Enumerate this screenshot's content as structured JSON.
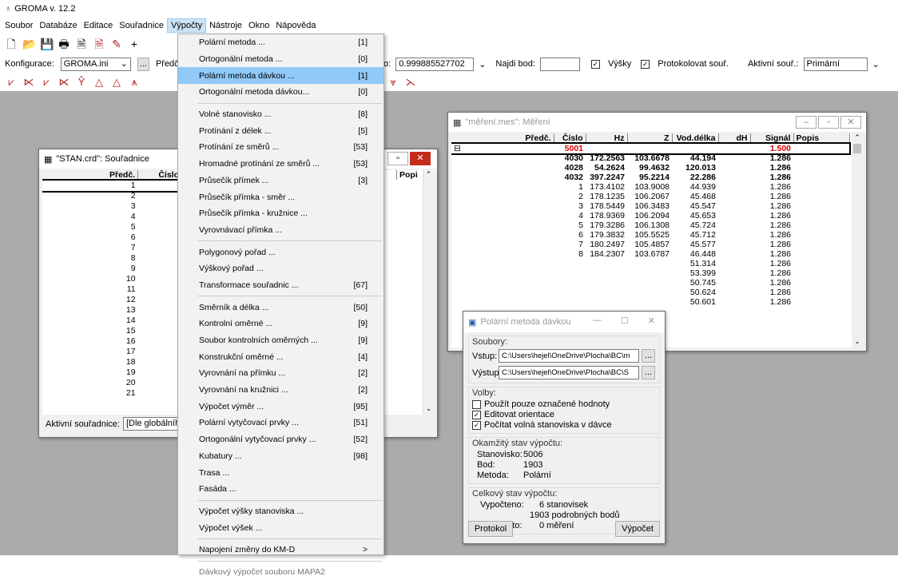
{
  "app": {
    "title": "GROMA v. 12.2"
  },
  "menubar": [
    "Soubor",
    "Databáze",
    "Editace",
    "Souřadnice",
    "Výpočty",
    "Nástroje",
    "Okno",
    "Nápověda"
  ],
  "toolbar2": {
    "config_label": "Konfigurace:",
    "config_value": "GROMA.ini",
    "predcisli_label": "Předčís",
    "scale_prefix": "o:",
    "scale_value": "0.999885527702",
    "find_label": "Najdi bod:",
    "vysky_label": "Výšky",
    "protokol_label": "Protokolovat souř.",
    "active_label": "Aktivní souř.:",
    "active_value": "Primární"
  },
  "menu": {
    "items": [
      {
        "label": "Polární metoda ...",
        "key": "[1]"
      },
      {
        "label": "Ortogonální metoda ...",
        "key": "[0]"
      },
      {
        "label": "Polární metoda dávkou ...",
        "key": "[1]",
        "hl": true
      },
      {
        "label": "Ortogonální metoda dávkou...",
        "key": "[0]"
      },
      {
        "sep": true
      },
      {
        "label": "Volné stanovisko ...",
        "key": "[8]"
      },
      {
        "label": "Protínání z délek ...",
        "key": "[5]"
      },
      {
        "label": "Protínání ze směrů ...",
        "key": "[53]"
      },
      {
        "label": "Hromadné protínání ze směrů ...",
        "key": "[53]"
      },
      {
        "label": "Průsečík přímek ...",
        "key": "[3]"
      },
      {
        "label": "Průsečík přímka - směr ...",
        "key": ""
      },
      {
        "label": "Průsečík přímka - kružnice ...",
        "key": ""
      },
      {
        "label": "Vyrovnávací přímka ...",
        "key": ""
      },
      {
        "sep": true
      },
      {
        "label": "Polygonový pořad ...",
        "key": ""
      },
      {
        "label": "Výškový pořad ...",
        "key": ""
      },
      {
        "label": "Transformace souřadnic ...",
        "key": "[67]"
      },
      {
        "sep": true
      },
      {
        "label": "Směrník a délka ...",
        "key": "[50]"
      },
      {
        "label": "Kontrolní oměrné ...",
        "key": "[9]"
      },
      {
        "label": "Soubor kontrolních oměrných ...",
        "key": "[9]"
      },
      {
        "label": "Konstrukční oměrné ...",
        "key": "[4]"
      },
      {
        "label": "Vyrovnání na přímku ...",
        "key": "[2]"
      },
      {
        "label": "Vyrovnání na kružnici ...",
        "key": "[2]"
      },
      {
        "label": "Výpočet výměr ...",
        "key": "[95]"
      },
      {
        "label": "Polární vytyčovací prvky ...",
        "key": "[51]"
      },
      {
        "label": "Ortogonální vytyčovací prvky ...",
        "key": "[52]"
      },
      {
        "label": "Kubatury ...",
        "key": "[98]"
      },
      {
        "label": "Trasa ...",
        "key": ""
      },
      {
        "label": "Fasáda ...",
        "key": ""
      },
      {
        "sep": true
      },
      {
        "label": "Výpočet výšky stanoviska ...",
        "key": ""
      },
      {
        "label": "Výpočet výšek ...",
        "key": ""
      },
      {
        "sep": true
      },
      {
        "label": "Napojení změny do KM-D",
        "key": ">"
      },
      {
        "sep": true
      },
      {
        "label": "Dávkový výpočet souboru MAPA2",
        "key": "",
        "dis": true
      }
    ]
  },
  "stan": {
    "title": "\"STAN.crd\": Souřadnice",
    "headers": [
      "Předč.",
      "Číslo"
    ],
    "extra_headers": [
      "v.",
      "Popi"
    ],
    "rows": [
      "1",
      "2",
      "3",
      "4",
      "5",
      "6",
      "7",
      "8",
      "9",
      "10",
      "11",
      "12",
      "13",
      "14",
      "15",
      "16",
      "17",
      "18",
      "19",
      "20",
      "21"
    ],
    "status_label": "Aktivní souřadnice:",
    "status_value": "[Dle globálního n"
  },
  "mereni": {
    "title": "\"měření.mes\": Měření",
    "headers": [
      "Předč.",
      "Číslo",
      "Hz",
      "Z",
      "Vod.délka",
      "dH",
      "Signál",
      "Popis"
    ],
    "station": {
      "cislo": "5001",
      "signal": "1.500"
    },
    "rows": [
      {
        "c": "4030",
        "hz": "172.2563",
        "z": "103.6678",
        "d": "44.194",
        "s": "1.286",
        "b": true
      },
      {
        "c": "4028",
        "hz": "54.2624",
        "z": "99.4632",
        "d": "120.013",
        "s": "1.286",
        "b": true
      },
      {
        "c": "4032",
        "hz": "397.2247",
        "z": "95.2214",
        "d": "22.286",
        "s": "1.286",
        "b": true
      },
      {
        "c": "1",
        "hz": "173.4102",
        "z": "103.9008",
        "d": "44.939",
        "s": "1.286"
      },
      {
        "c": "2",
        "hz": "178.1235",
        "z": "106.2067",
        "d": "45.468",
        "s": "1.286"
      },
      {
        "c": "3",
        "hz": "178.5449",
        "z": "106.3483",
        "d": "45.547",
        "s": "1.286"
      },
      {
        "c": "4",
        "hz": "178.9369",
        "z": "106.2094",
        "d": "45.653",
        "s": "1.286"
      },
      {
        "c": "5",
        "hz": "179.3286",
        "z": "106.1308",
        "d": "45.724",
        "s": "1.286"
      },
      {
        "c": "6",
        "hz": "179.3832",
        "z": "105.5525",
        "d": "45.712",
        "s": "1.286"
      },
      {
        "c": "7",
        "hz": "180.2497",
        "z": "105.4857",
        "d": "45.577",
        "s": "1.286"
      },
      {
        "c": "8",
        "hz": "184.2307",
        "z": "103.6787",
        "d": "46.448",
        "s": "1.286"
      },
      {
        "c": "",
        "hz": "",
        "z": "",
        "d": "51.314",
        "s": "1.286"
      },
      {
        "c": "",
        "hz": "",
        "z": "",
        "d": "53.399",
        "s": "1.286"
      },
      {
        "c": "",
        "hz": "",
        "z": "",
        "d": "50.745",
        "s": "1.286"
      },
      {
        "c": "",
        "hz": "",
        "z": "",
        "d": "50.624",
        "s": "1.286"
      },
      {
        "c": "",
        "hz": "",
        "z": "",
        "d": "50.601",
        "s": "1.286"
      }
    ]
  },
  "dialog": {
    "title": "Polární metoda dávkou",
    "files_label": "Soubory:",
    "input_label": "Vstup:",
    "input_value": "C:\\Users\\hejel\\OneDrive\\Plocha\\BC\\m",
    "output_label": "Výstup:",
    "output_value": "C:\\Users\\hejel\\OneDrive\\Plocha\\BC\\S",
    "browse": "...",
    "options_label": "Volby:",
    "opt1": "Použít pouze označené hodnoty",
    "opt2": "Editovat orientace",
    "opt3": "Počítat volná stanoviska v dávce",
    "state_label": "Okamžitý stav výpočtu:",
    "stanovisko_label": "Stanovisko:",
    "stanovisko_value": "5006",
    "bod_label": "Bod:",
    "bod_value": "1903",
    "metoda_label": "Metoda:",
    "metoda_value": "Polární",
    "total_label": "Celkový stav výpočtu:",
    "vypocteno_label": "Vypočteno:",
    "vypocteno_1": "6  stanovisek",
    "vypocteno_2": "1903  podrobných bodů",
    "nepouzito_label": "Nepoužito:",
    "nepouzito_value": "0  měření",
    "btn_protokol": "Protokol",
    "btn_vypocet": "Výpočet"
  }
}
